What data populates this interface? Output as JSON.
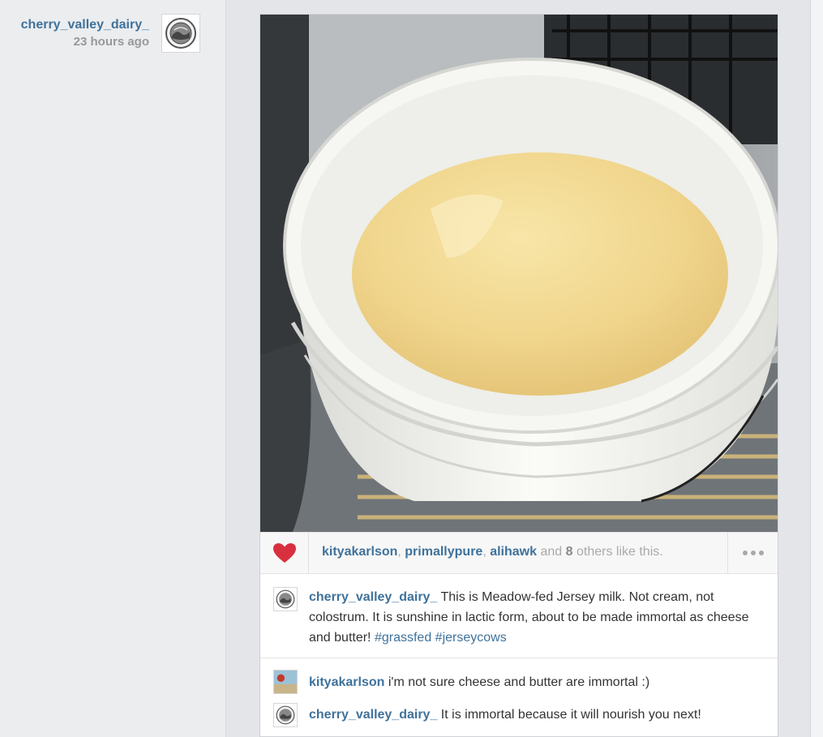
{
  "post_meta": {
    "username": "cherry_valley_dairy_",
    "time_ago": "23 hours ago"
  },
  "likes": {
    "users": [
      "kityakarlson",
      "primallypure",
      "alihawk"
    ],
    "and_text": "and",
    "others_count": "8",
    "suffix": "others like this."
  },
  "caption": {
    "username": "cherry_valley_dairy_",
    "text": "This is Meadow-fed Jersey milk. Not cream, not colostrum. It is sunshine in lactic form, about to be made immortal as cheese and butter!",
    "hashtags": [
      "#grassfed",
      "#jerseycows"
    ]
  },
  "comments": [
    {
      "username": "kityakarlson",
      "text": "i'm not sure cheese and butter are immortal :)"
    },
    {
      "username": "cherry_valley_dairy_",
      "text": "It is immortal because it will nourish you next!"
    }
  ],
  "icons": {
    "like": "heart-icon",
    "more": "more-options-icon",
    "avatar_logo": "dairy-seal-logo"
  },
  "colors": {
    "link": "#3f729b",
    "heart": "#d9303f",
    "milk": "#f0d58c"
  }
}
